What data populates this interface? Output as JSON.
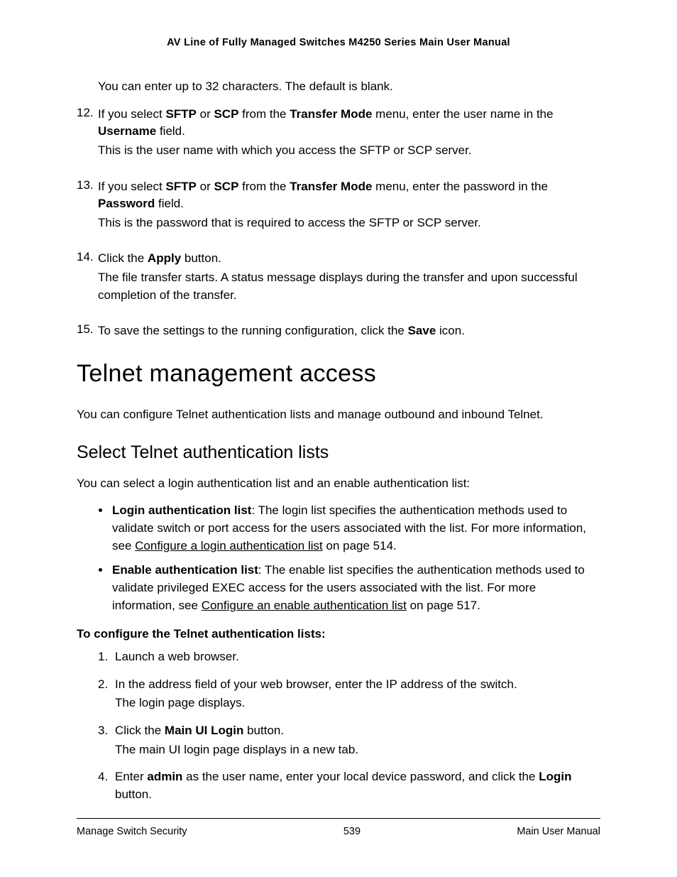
{
  "header": {
    "title": "AV Line of Fully Managed Switches M4250 Series Main User Manual"
  },
  "topBlock": {
    "preText": "You can enter up to 32 characters. The default is blank.",
    "items": [
      {
        "num": "12.",
        "line_pre": "If you select ",
        "b1": "SFTP",
        "mid1": " or ",
        "b2": "SCP",
        "mid2": " from the ",
        "b3": "Transfer Mode",
        "mid3": " menu, enter the user name in the ",
        "b4": "Username",
        "tail": " field.",
        "follow": "This is the user name with which you access the SFTP or SCP server."
      },
      {
        "num": "13.",
        "line_pre": "If you select ",
        "b1": "SFTP",
        "mid1": " or ",
        "b2": "SCP",
        "mid2": " from the ",
        "b3": "Transfer Mode",
        "mid3": " menu, enter the password in the ",
        "b4": "Password",
        "tail": " field.",
        "follow": "This is the password that is required to access the SFTP or SCP server."
      },
      {
        "num": "14.",
        "line_pre": "Click the ",
        "b1": "Apply",
        "tail": " button.",
        "follow": "The file transfer starts. A status message displays during the transfer and upon successful completion of the transfer."
      },
      {
        "num": "15.",
        "line_pre": "To save the settings to the running configuration, click the ",
        "b1": "Save",
        "tail": " icon."
      }
    ]
  },
  "section": {
    "h1": "Telnet management access",
    "intro1": "You can configure Telnet authentication lists and manage outbound and inbound Telnet.",
    "h2": "Select Telnet authentication lists",
    "intro2": "You can select a login authentication list and an enable authentication list:",
    "bullets": [
      {
        "boldLabel": "Login authentication list",
        "text1": ": The login list specifies the authentication methods used to validate switch or port access for the users associated with the list. For more information, see ",
        "link": "Configure a login authentication list",
        "text2": " on page 514."
      },
      {
        "boldLabel": "Enable authentication list",
        "text1": ": The enable list specifies the authentication methods used to validate privileged EXEC access for the users associated with the list. For more information, see ",
        "link": "Configure an enable authentication list",
        "text2": " on page 517."
      }
    ],
    "subHeading": "To configure the Telnet authentication lists:",
    "steps": [
      {
        "text": "Launch a web browser."
      },
      {
        "text": "In the address field of your web browser, enter the IP address of the switch.",
        "follow": "The login page displays."
      },
      {
        "pre": "Click the ",
        "b": "Main UI Login",
        "post": " button.",
        "follow": "The main UI login page displays in a new tab."
      },
      {
        "pre": "Enter ",
        "b": "admin",
        "mid": " as the user name, enter your local device password, and click the ",
        "b2": "Login",
        "post": " button."
      }
    ]
  },
  "footer": {
    "left": "Manage Switch Security",
    "center": "539",
    "right": "Main User Manual"
  }
}
